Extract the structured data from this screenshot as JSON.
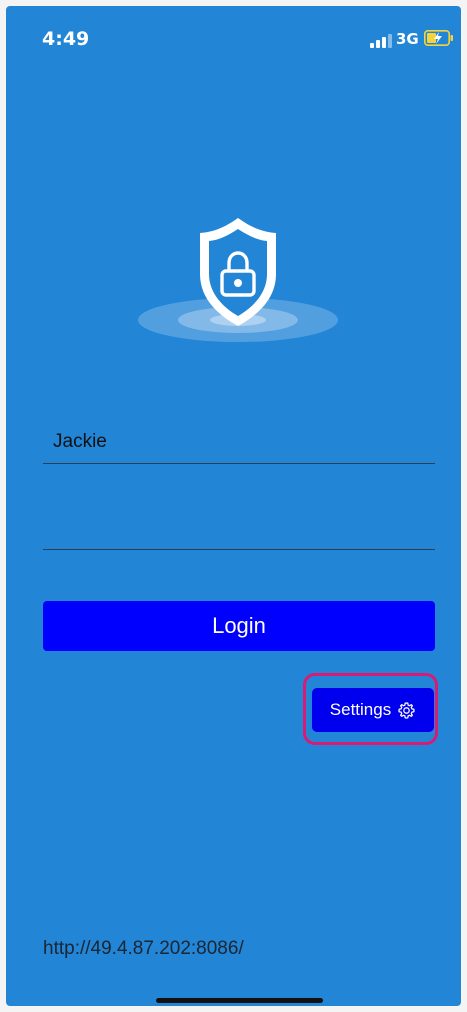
{
  "status_bar": {
    "time": "4:49",
    "network": "3G",
    "signal_icon": "signal-bars-icon",
    "battery_icon": "battery-charging-icon"
  },
  "hero": {
    "icon": "shield-lock-icon"
  },
  "login_form": {
    "username_value": "Jackie",
    "password_value": "",
    "login_label": "Login"
  },
  "settings": {
    "label": "Settings",
    "icon": "gear-icon"
  },
  "footer": {
    "server_url": "http://49.4.87.202:8086/"
  },
  "colors": {
    "background": "#2285d6",
    "primary_button": "#0000ff",
    "highlight": "#d81b74",
    "battery": "#f5d33b"
  }
}
